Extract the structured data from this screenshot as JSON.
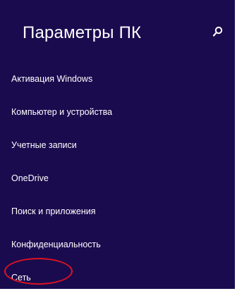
{
  "header": {
    "title": "Параметры ПК"
  },
  "search": {
    "icon": "search-icon"
  },
  "nav": {
    "items": [
      {
        "label": "Активация Windows"
      },
      {
        "label": "Компьютер и устройства"
      },
      {
        "label": "Учетные записи"
      },
      {
        "label": "OneDrive"
      },
      {
        "label": "Поиск и приложения"
      },
      {
        "label": "Конфиденциальность"
      },
      {
        "label": "Сеть"
      }
    ],
    "highlighted": "Сеть"
  },
  "colors": {
    "background": "#1a0b4f",
    "text": "#ffffff",
    "highlight": "#e0121d"
  }
}
